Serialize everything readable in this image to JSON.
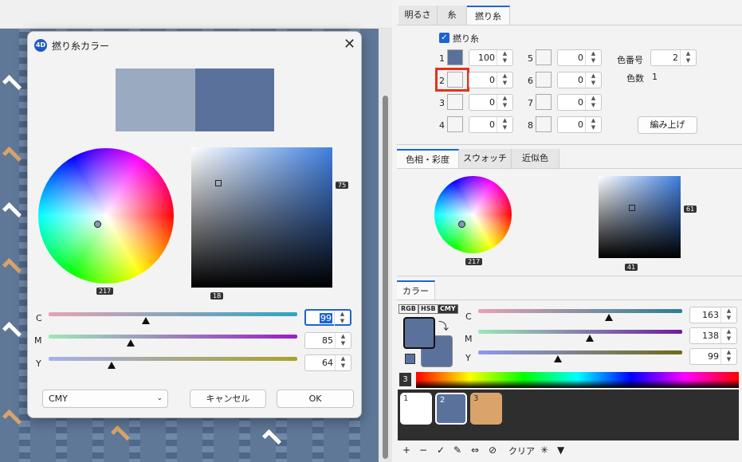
{
  "dialog": {
    "title": "撚り糸カラー",
    "icon_text": "4D",
    "wheel_hue_label": "217",
    "square_right_label": "75",
    "square_bottom_label": "18",
    "sliders": [
      {
        "label": "C",
        "value": "99",
        "level": 0.41
      },
      {
        "label": "M",
        "value": "85",
        "level": 0.33
      },
      {
        "label": "Y",
        "value": "64",
        "level": 0.25
      }
    ],
    "mode_select": "CMY",
    "cancel_label": "キャンセル",
    "ok_label": "OK"
  },
  "right_panel": {
    "top_tabs": [
      "明るさ",
      "糸",
      "撚り糸"
    ],
    "ply_checkbox_label": "撚り糸",
    "ply_rows_left": [
      {
        "num": "1",
        "value": "100"
      },
      {
        "num": "2",
        "value": "0"
      },
      {
        "num": "3",
        "value": "0"
      },
      {
        "num": "4",
        "value": "0"
      }
    ],
    "ply_rows_right": [
      {
        "num": "5",
        "value": "0"
      },
      {
        "num": "6",
        "value": "0"
      },
      {
        "num": "7",
        "value": "0"
      },
      {
        "num": "8",
        "value": "0"
      }
    ],
    "color_number_label": "色番号",
    "color_number_value": "2",
    "color_count_label": "色数",
    "color_count_value": "1",
    "knit_button": "編み上げ",
    "hue_tabs": [
      "色相・彩度",
      "スウォッチ",
      "近似色"
    ],
    "mini_wheel_label": "217",
    "mini_square_right_label": "61",
    "mini_square_bottom_label": "41",
    "color_tab": "カラー",
    "color_modes": [
      "RGB",
      "HSB",
      "CMY"
    ],
    "sliders": [
      {
        "label": "C",
        "value": "163",
        "level": 0.64
      },
      {
        "label": "M",
        "value": "138",
        "level": 0.54
      },
      {
        "label": "Y",
        "value": "99",
        "level": 0.39
      }
    ],
    "spectrum_number": "3",
    "palette": [
      {
        "num": "1",
        "color": "#ffffff"
      },
      {
        "num": "2",
        "color": "#5a719b"
      },
      {
        "num": "3",
        "color": "#d9a36b"
      }
    ],
    "toolbar_clear": "クリア"
  },
  "colors": {
    "current": "#5a719b",
    "previous": "#9aaac1",
    "highlight": "#e8301c"
  }
}
